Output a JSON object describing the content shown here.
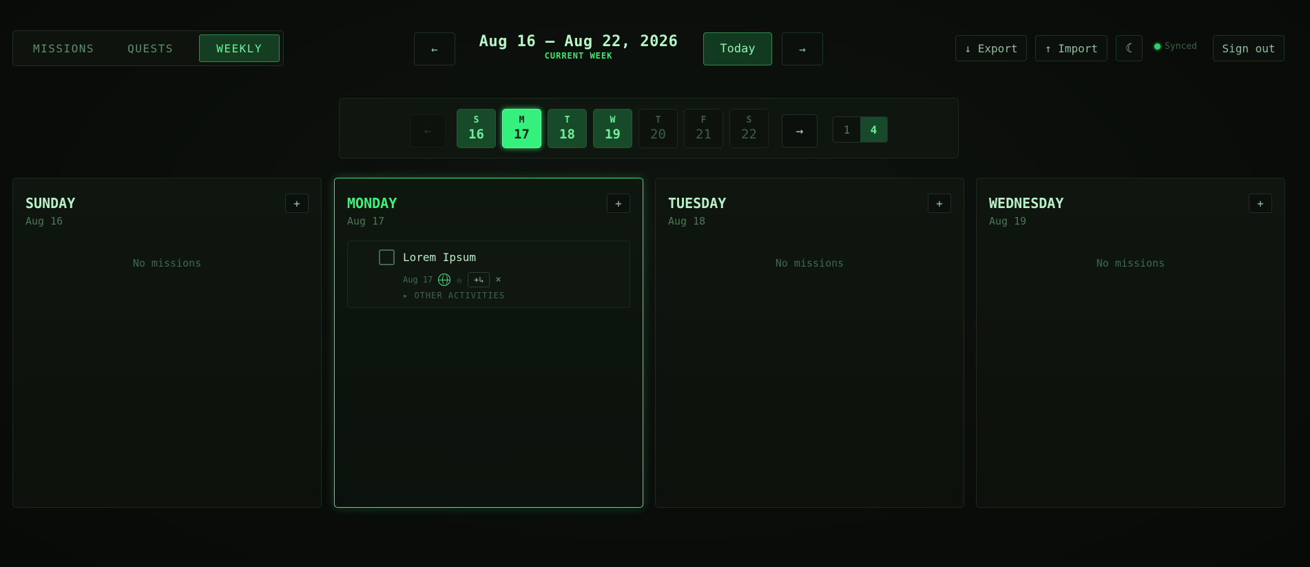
{
  "tabs": [
    {
      "label": "MISSIONS"
    },
    {
      "label": "QUESTS"
    },
    {
      "label": "WEEKLY"
    }
  ],
  "header": {
    "prev_arrow": "←",
    "next_arrow": "→",
    "week_range": "Aug 16 – Aug 22, 2026",
    "week_subtitle": "CURRENT WEEK",
    "today_label": "Today"
  },
  "toolbar": {
    "export_label": "↓ Export",
    "import_label": "↑ Import",
    "theme_icon": "☾",
    "synced_label": "Synced",
    "signout_label": "Sign out"
  },
  "strip": {
    "prev_arrow": "←",
    "next_arrow": "→",
    "days": [
      {
        "letter": "S",
        "num": "16",
        "state": "past"
      },
      {
        "letter": "M",
        "num": "17",
        "state": "current"
      },
      {
        "letter": "T",
        "num": "18",
        "state": "past"
      },
      {
        "letter": "W",
        "num": "19",
        "state": "past"
      },
      {
        "letter": "T",
        "num": "20",
        "state": "future"
      },
      {
        "letter": "F",
        "num": "21",
        "state": "future"
      },
      {
        "letter": "S",
        "num": "22",
        "state": "future"
      }
    ],
    "pages": [
      "1",
      "4"
    ]
  },
  "columns": [
    {
      "name": "SUNDAY",
      "date": "Aug 16",
      "add": "+",
      "empty": "No missions"
    },
    {
      "name": "MONDAY",
      "date": "Aug 17",
      "add": "+",
      "mission": {
        "title": "Lorem Ipsum",
        "date": "Aug 17",
        "star": "☆",
        "subtask": "+↳",
        "delete": "×",
        "other": "▸ OTHER ACTIVITIES"
      }
    },
    {
      "name": "TUESDAY",
      "date": "Aug 18",
      "add": "+",
      "empty": "No missions"
    },
    {
      "name": "WEDNESDAY",
      "date": "Aug 19",
      "add": "+",
      "empty": "No missions"
    }
  ],
  "colors": {
    "accent": "#3ee47a",
    "background": "#0a0d0a",
    "panel_border": "#1d2b1f"
  }
}
